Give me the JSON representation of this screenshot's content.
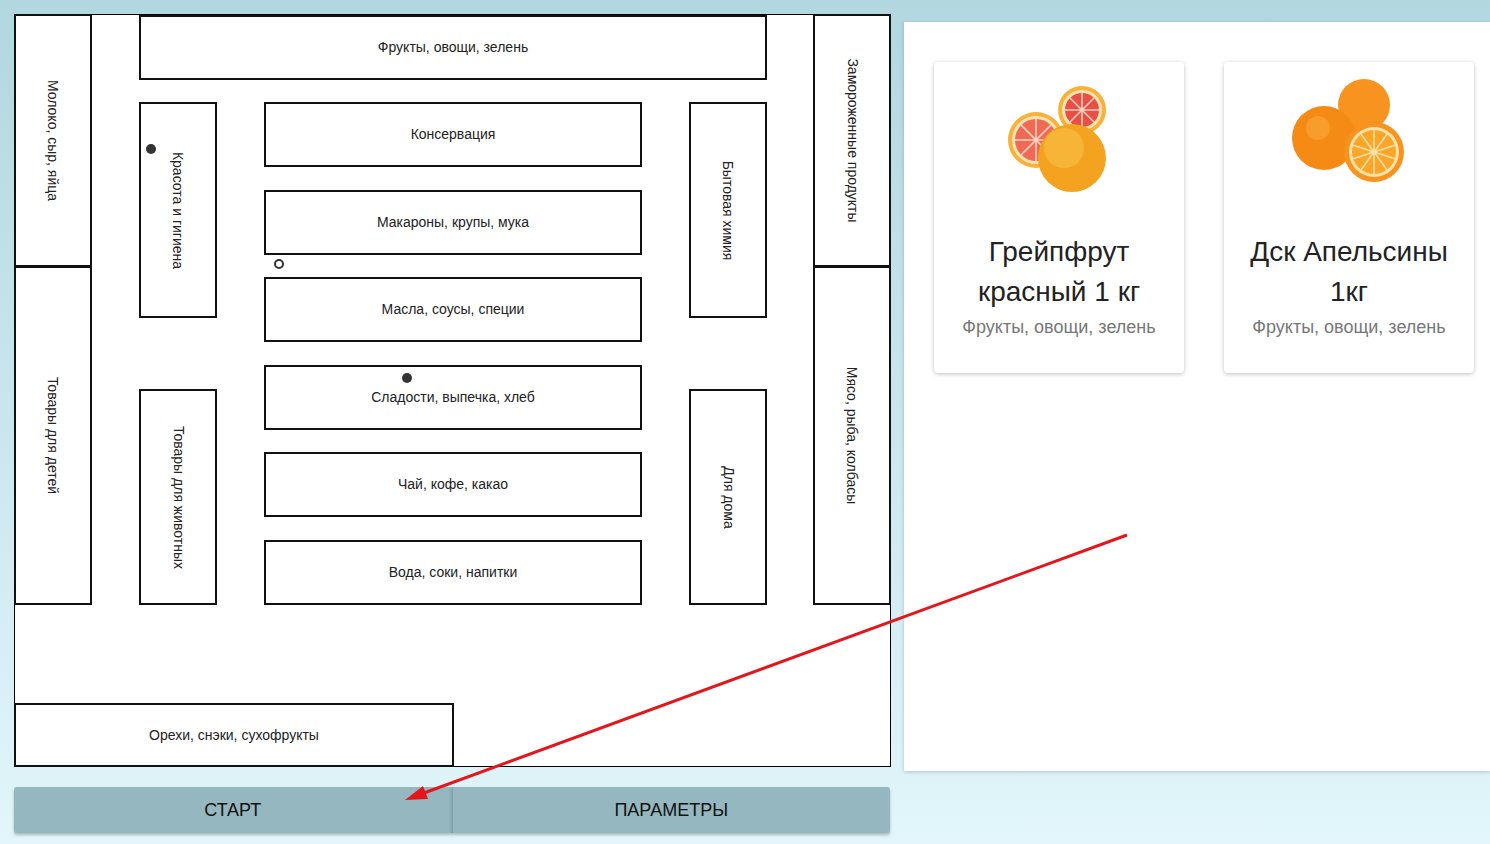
{
  "map": {
    "shelves": [
      {
        "label": "Молоко, сыр, яйца",
        "kind": "vertical"
      },
      {
        "label": "Товары для детей",
        "kind": "vertical"
      },
      {
        "label": "Фрукты, овощи, зелень",
        "kind": "horizontal"
      },
      {
        "label": "Красота и гигиена",
        "kind": "vertical"
      },
      {
        "label": "Консервация",
        "kind": "horizontal"
      },
      {
        "label": "Макароны, крупы, мука",
        "kind": "horizontal"
      },
      {
        "label": "Масла, соусы, специи",
        "kind": "horizontal"
      },
      {
        "label": "Сладости, выпечка, хлеб",
        "kind": "horizontal"
      },
      {
        "label": "Чай, кофе, какао",
        "kind": "horizontal"
      },
      {
        "label": "Вода, соки, напитки",
        "kind": "horizontal"
      },
      {
        "label": "Товары для животных",
        "kind": "vertical"
      },
      {
        "label": "Бытовая химия",
        "kind": "vertical"
      },
      {
        "label": "Для дома",
        "kind": "vertical"
      },
      {
        "label": "Замороженные продукты",
        "kind": "vertical"
      },
      {
        "label": "Мясо, рыба, колбасы",
        "kind": "vertical"
      },
      {
        "label": "Орехи, снэки, сухофрукты",
        "kind": "horizontal"
      }
    ],
    "markers": [
      {
        "kind": "filled"
      },
      {
        "kind": "hollow"
      },
      {
        "kind": "filled"
      }
    ]
  },
  "buttons": [
    {
      "label": "СТАРТ"
    },
    {
      "label": "ПАРАМЕТРЫ"
    }
  ],
  "products": [
    {
      "name": "Грейпфрут красный 1 кг",
      "category": "Фрукты, овощи, зелень",
      "kind": "grapefruit"
    },
    {
      "name": "Дск Апельсины 1кг",
      "category": "Фрукты, овощи, зелень",
      "kind": "orange"
    }
  ]
}
